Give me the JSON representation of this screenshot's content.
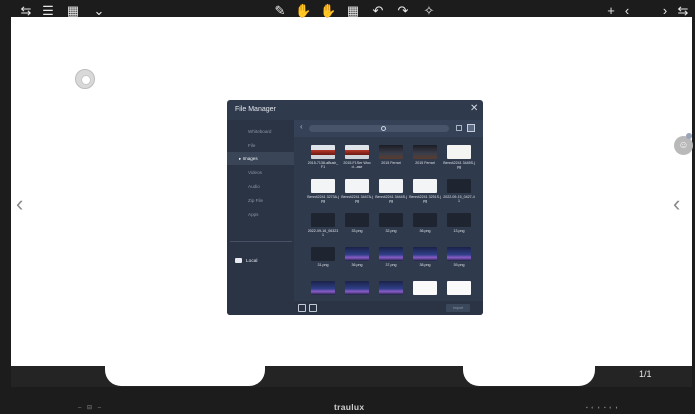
{
  "file_manager": {
    "title": "File Manager",
    "close": "✕",
    "sidebar": [
      {
        "label": "Whiteboard"
      },
      {
        "label": "File"
      },
      {
        "label": "Images",
        "active": true
      },
      {
        "label": "Videos"
      },
      {
        "label": "Audio"
      },
      {
        "label": "Zip File"
      },
      {
        "label": "Apps"
      }
    ],
    "local_label": "Local",
    "search_placeholder": "",
    "open_label": "Import",
    "items": [
      {
        "label": "2015-7138-aBush_F1",
        "thumb": "car"
      },
      {
        "label": "2015-F1Ser Wood...ase",
        "thumb": "car"
      },
      {
        "label": "2015 Ferrari",
        "thumb": "dark"
      },
      {
        "label": "2015 Ferrari",
        "thumb": "dark"
      },
      {
        "label": "Benn42241 3445S.jpg",
        "thumb": "lightcar"
      },
      {
        "label": "Benn42241 3273A.jpg",
        "thumb": "light"
      },
      {
        "label": "Benn42241 3447A.jpg",
        "thumb": "light"
      },
      {
        "label": "Benn42241 3444S.jpg",
        "thumb": "light"
      },
      {
        "label": "Benn42241 3251S.jpg",
        "thumb": "light"
      },
      {
        "label": "2022-09-15_0427-41",
        "thumb": "doc"
      },
      {
        "label": "2022-09-16_063231",
        "thumb": "doc"
      },
      {
        "label": "33.png",
        "thumb": "doc"
      },
      {
        "label": "32.png",
        "thumb": "doc"
      },
      {
        "label": "36.png",
        "thumb": "doc"
      },
      {
        "label": "13.png",
        "thumb": "doc"
      },
      {
        "label": "31.png",
        "thumb": "doc"
      },
      {
        "label": "36.png",
        "thumb": "night"
      },
      {
        "label": "37.png",
        "thumb": "night"
      },
      {
        "label": "38.png",
        "thumb": "night"
      },
      {
        "label": "39.png",
        "thumb": "night"
      },
      {
        "label": "",
        "thumb": "night"
      },
      {
        "label": "",
        "thumb": "night"
      },
      {
        "label": "",
        "thumb": "night"
      },
      {
        "label": "",
        "thumb": "white"
      },
      {
        "label": "",
        "thumb": "white"
      }
    ]
  },
  "toolbar": {
    "left": [
      "⇆",
      "☰",
      "▦",
      "⌄"
    ],
    "center": [
      "✎",
      "✋",
      "✋",
      "▦",
      "↶",
      "↷",
      "✧"
    ],
    "right_add": "+",
    "prev": "‹",
    "page": "1/1",
    "next": "›",
    "swap": "⇆"
  },
  "side_arrows": {
    "left": "‹",
    "right": "‹"
  },
  "brand": "traulux",
  "bezel_left": "– ⊟ –",
  "bezel_right": "▪ ◐ ◐ ▪ ◐ ◐"
}
